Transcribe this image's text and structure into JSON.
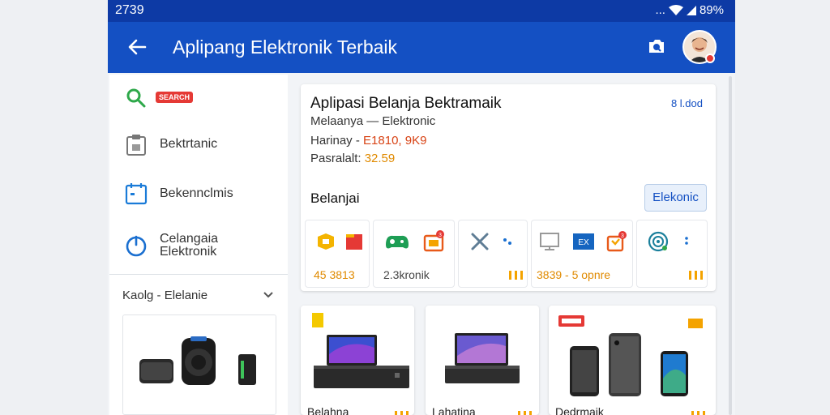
{
  "status_bar": {
    "time": "2739",
    "signal": "...",
    "battery": "89%"
  },
  "app_bar": {
    "title": "Aplipang Elektronik Terbaik"
  },
  "sidebar": {
    "search_badge": "SEARCH",
    "items": [
      {
        "label": "Bektrtanic"
      },
      {
        "label": "Bekennclmis"
      },
      {
        "label": "Celangaia\nElektronik"
      }
    ],
    "section_title": "Kaolg - Elelanie"
  },
  "main_card": {
    "title": "Aplipasi Belanja Bektramaik",
    "code": "8 l.dod",
    "line1_label": "Melaanya",
    "line1_value": "— Elektronic",
    "line2_label": "Harinay -",
    "line2_value": "E1810, 9K9",
    "line3_label": "Pasralalt:",
    "line3_value": "32.59",
    "section_label": "Belanjai",
    "section_button": "Elekonic",
    "tiles": [
      {
        "label": "45 3813"
      },
      {
        "label": "2.3kronik"
      },
      {
        "label": ""
      },
      {
        "label": "3839 - 5 opnre"
      },
      {
        "label": ""
      }
    ],
    "badge_counts": [
      "3",
      "3"
    ]
  },
  "products": [
    {
      "label": "Belahna"
    },
    {
      "label": "Lahatina"
    },
    {
      "label": "Dedrmaik"
    }
  ],
  "colors": {
    "status_bar": "#0d3aa5",
    "app_bar": "#1450c3",
    "accent_orange": "#e08a00",
    "accent_red": "#e53935"
  }
}
